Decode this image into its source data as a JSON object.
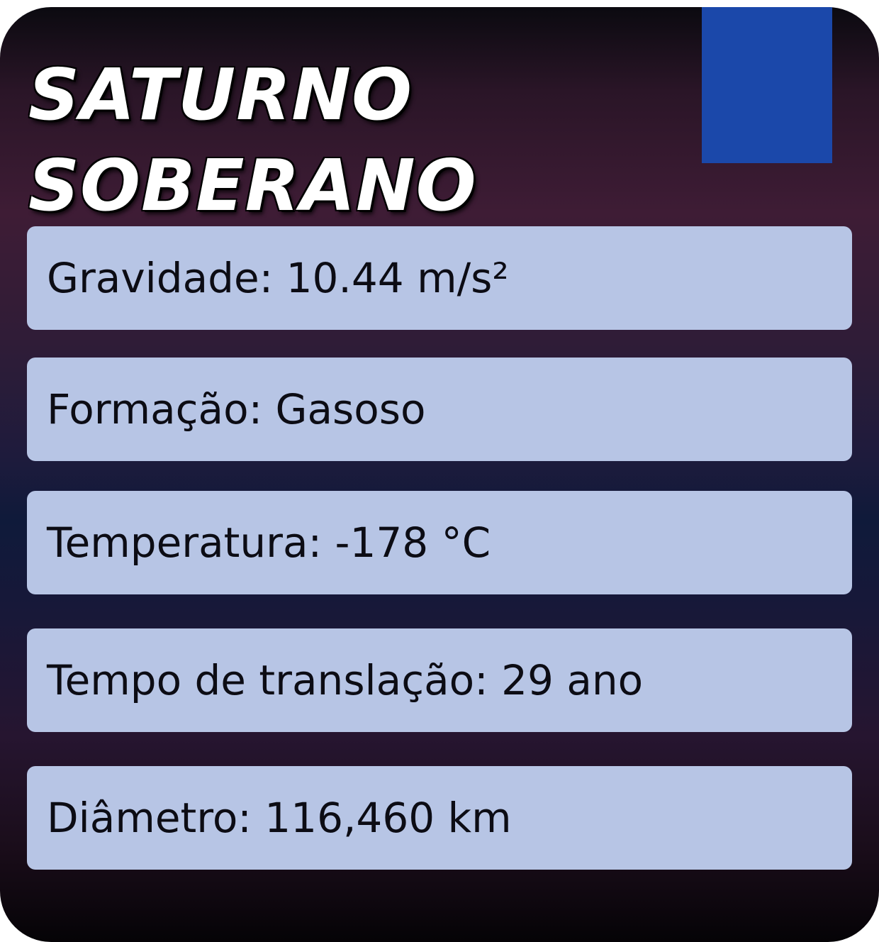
{
  "card": {
    "title_line1": "SATURNO",
    "title_line2": "SOBERANO",
    "badge_color": "#1b48aa",
    "panel_color": "#b7c5e5"
  },
  "stats": [
    {
      "text": "Gravidade: 10.44 m/s²"
    },
    {
      "text": "Formação: Gasoso"
    },
    {
      "text": "Temperatura: -178 °C"
    },
    {
      "text": "Tempo de translação: 29 ano"
    },
    {
      "text": "Diâmetro: 116,460 km"
    }
  ]
}
